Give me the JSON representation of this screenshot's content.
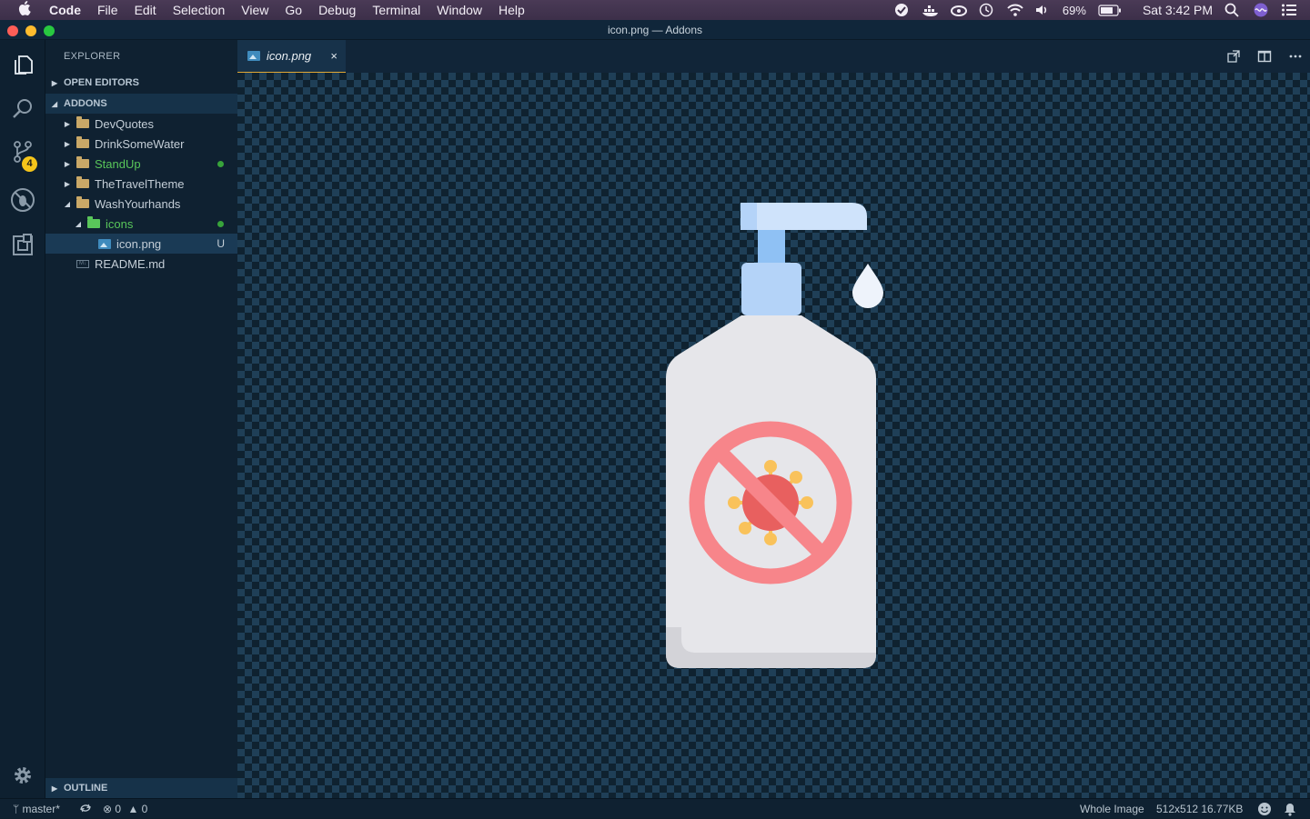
{
  "menubar": {
    "app_name": "Code",
    "items": [
      "File",
      "Edit",
      "Selection",
      "View",
      "Go",
      "Debug",
      "Terminal",
      "Window",
      "Help"
    ],
    "battery": "69%",
    "clock": "Sat 3:42 PM"
  },
  "window": {
    "title": "icon.png — Addons"
  },
  "activity_bar": {
    "scm_badge": "4"
  },
  "sidebar": {
    "header": "EXPLORER",
    "open_editors": "OPEN EDITORS",
    "root": "ADDONS",
    "items": [
      {
        "label": "DevQuotes"
      },
      {
        "label": "DrinkSomeWater"
      },
      {
        "label": "StandUp"
      },
      {
        "label": "TheTravelTheme"
      },
      {
        "label": "WashYourhands"
      },
      {
        "label": "icons"
      },
      {
        "label": "icon.png",
        "status": "U"
      },
      {
        "label": "README.md"
      }
    ],
    "outline": "OUTLINE"
  },
  "editor": {
    "tab_label": "icon.png",
    "tab_close": "×"
  },
  "statusbar": {
    "branch": "master*",
    "errors": "0",
    "warnings": "0",
    "zoom": "Whole Image",
    "image_info": "512x512 16.77KB"
  },
  "colors": {
    "accent": "#e0a834",
    "git_added": "#59c65a",
    "badge": "#f5c51a"
  }
}
